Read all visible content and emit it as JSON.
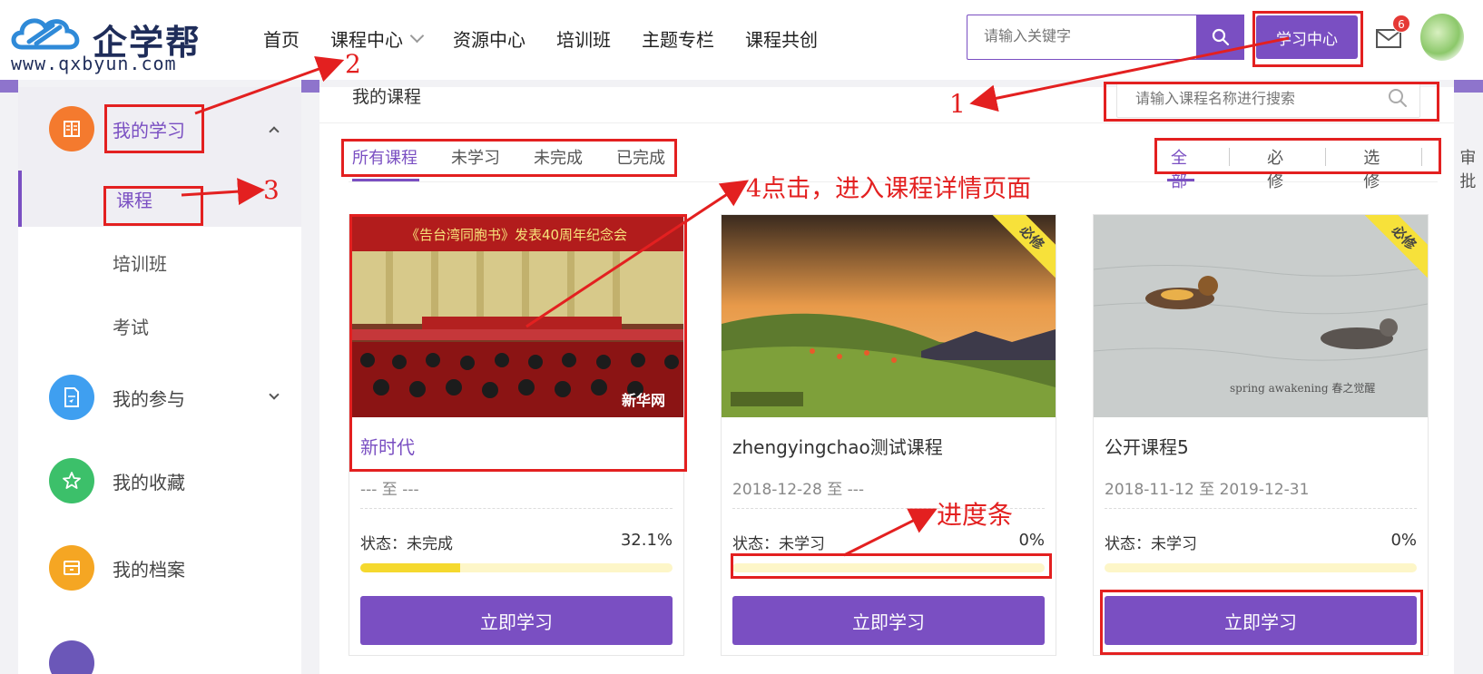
{
  "header": {
    "logo_text": "企学帮",
    "logo_url": "www.qxbyun.com",
    "nav": [
      {
        "label": "首页",
        "dropdown": false
      },
      {
        "label": "课程中心",
        "dropdown": true
      },
      {
        "label": "资源中心",
        "dropdown": false
      },
      {
        "label": "培训班",
        "dropdown": false
      },
      {
        "label": "主题专栏",
        "dropdown": false
      },
      {
        "label": "课程共创",
        "dropdown": false
      }
    ],
    "search_placeholder": "请输入关键字",
    "study_center_label": "学习中心",
    "mail_badge": "6"
  },
  "sidebar": {
    "groups": [
      {
        "label": "我的学习",
        "icon": "book-icon",
        "color": "#f47a2e",
        "active": true
      },
      {
        "label": "我的参与",
        "icon": "document-icon",
        "color": "#3f9ff0",
        "active": false
      },
      {
        "label": "我的收藏",
        "icon": "star-icon",
        "color": "#3cc06a",
        "active": false
      },
      {
        "label": "我的档案",
        "icon": "archive-icon",
        "color": "#f5a623",
        "active": false
      }
    ],
    "sub_items": [
      {
        "label": "课程",
        "active": true
      },
      {
        "label": "培训班",
        "active": false
      },
      {
        "label": "考试",
        "active": false
      }
    ]
  },
  "main": {
    "title": "我的课程",
    "course_search_placeholder": "请输入课程名称进行搜索",
    "tabs": [
      "所有课程",
      "未学习",
      "未完成",
      "已完成"
    ],
    "filters": [
      "全部",
      "必修",
      "选修",
      "审批"
    ],
    "cards": [
      {
        "title": "新时代",
        "date": "--- 至 ---",
        "status": "状态：未完成",
        "percent": "32.1%",
        "progress": 0.321,
        "button": "立即学习",
        "ribbon": "",
        "img_caption": "《告台湾同胞书》发表40周年纪念会",
        "watermark": "新华网"
      },
      {
        "title": "zhengyingchao测试课程",
        "date": "2018-12-28 至 ---",
        "status": "状态：未学习",
        "percent": "0%",
        "progress": 0,
        "button": "立即学习",
        "ribbon": "必修",
        "img_caption": "",
        "watermark": ""
      },
      {
        "title": "公开课程5",
        "date": "2018-11-12 至 2019-12-31",
        "status": "状态：未学习",
        "percent": "0%",
        "progress": 0,
        "button": "立即学习",
        "ribbon": "必修",
        "img_caption": "",
        "watermark": "spring awakening 春之觉醒"
      }
    ]
  },
  "annotations": {
    "n1": "1",
    "n2": "2",
    "n3": "3",
    "n4": "4点击，进入课程详情页面",
    "progress_label": "进度条"
  },
  "colors": {
    "accent": "#7a4fc2",
    "annotation": "#e32020",
    "progress": "#f5d92e"
  }
}
